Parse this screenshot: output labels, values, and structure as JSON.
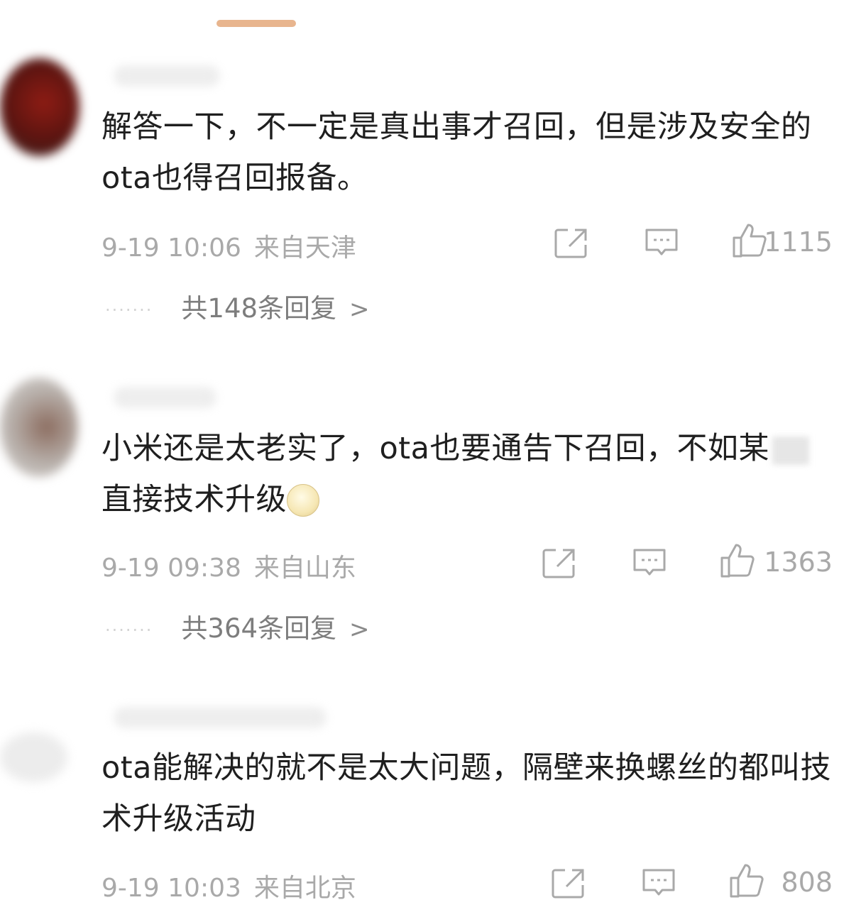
{
  "comments": [
    {
      "text": "解答一下，不一定是真出事才召回，但是涉及安全的ota也得召回报备。",
      "date": "9-19 10:06",
      "location": "来自天津",
      "likes": "1115",
      "replies": "共148条回复",
      "replies_chevron": ">"
    },
    {
      "text_part1": "小米还是太老实了，ota也要通告下召回，不如某",
      "text_part2": "直接技术升级",
      "emoji": "grimacing-face-emoji",
      "date": "9-19 09:38",
      "location": "来自山东",
      "likes": "1363",
      "replies": "共364条回复",
      "replies_chevron": ">"
    },
    {
      "text": "ota能解决的就不是太大问题，隔壁来换螺丝的都叫技术升级活动",
      "date": "9-19 10:03",
      "location": "来自北京",
      "likes": "808"
    }
  ],
  "icons": [
    "share-icon",
    "comment-icon",
    "like-icon"
  ],
  "colors": {
    "handle": "#e8b58e",
    "meta": "#a9a9a9",
    "text": "#1f1f1f"
  }
}
